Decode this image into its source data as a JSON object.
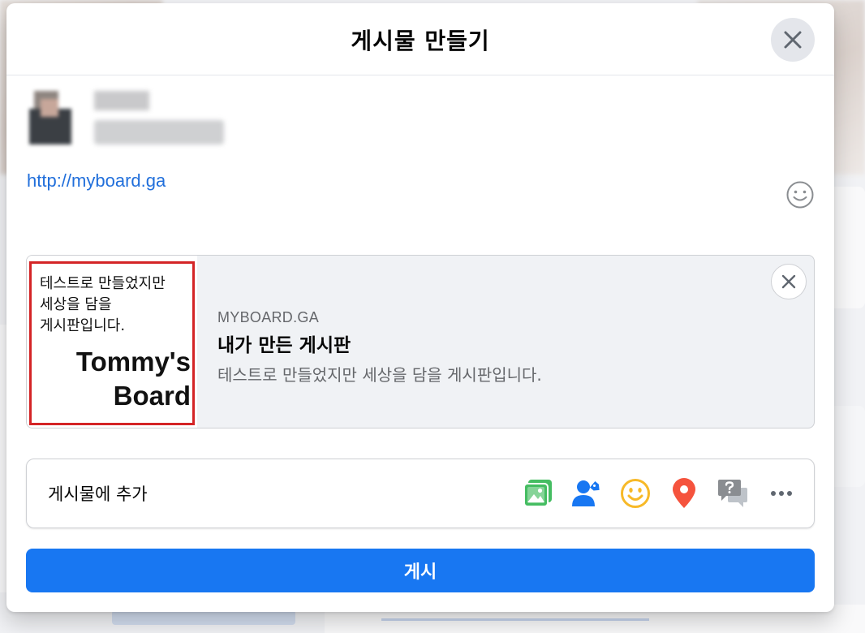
{
  "dialog": {
    "title": "게시물 만들기",
    "close_icon": "close-icon"
  },
  "author": {
    "name": "",
    "audience": ""
  },
  "composer": {
    "text": "http://myboard.ga",
    "emoji_icon": "smile-icon"
  },
  "link_preview": {
    "thumbnail_text": "테스트로 만들었지만 세상을 담을 게시판입니다.",
    "thumbnail_brand": "Tommy's Board",
    "domain": "MYBOARD.GA",
    "title": "내가 만든 게시판",
    "description": "테스트로 만들었지만 세상을 담을 게시판입니다.",
    "remove_icon": "close-icon"
  },
  "add_to_post": {
    "label": "게시물에 추가",
    "icons": [
      {
        "name": "photo-video-icon",
        "color": "#45bd62"
      },
      {
        "name": "tag-people-icon",
        "color": "#1877f2"
      },
      {
        "name": "feeling-activity-icon",
        "color": "#f7b928"
      },
      {
        "name": "check-in-icon",
        "color": "#f5533d"
      },
      {
        "name": "ask-question-icon",
        "color": "#8a8d91"
      },
      {
        "name": "more-icon",
        "color": "#606770"
      }
    ]
  },
  "submit": {
    "label": "게시"
  },
  "colors": {
    "accent": "#1877f2",
    "link": "#216fdb",
    "thumbnail_border": "#d42426"
  }
}
